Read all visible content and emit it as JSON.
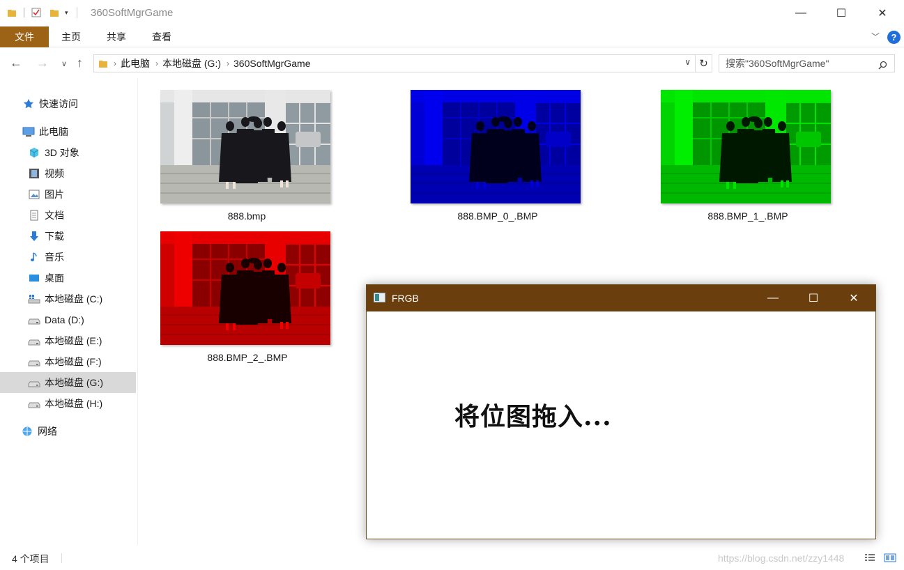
{
  "window": {
    "title": "360SoftMgrGame",
    "minimize": "—",
    "maximize": "☐",
    "close": "✕"
  },
  "ribbon": {
    "tabs": [
      {
        "label": "文件"
      },
      {
        "label": "主页"
      },
      {
        "label": "共享"
      },
      {
        "label": "查看"
      }
    ],
    "help": "?"
  },
  "address": {
    "crumbs": [
      "此电脑",
      "本地磁盘 (G:)",
      "360SoftMgrGame"
    ],
    "search_placeholder": "搜索\"360SoftMgrGame\""
  },
  "sidebar": {
    "items": [
      {
        "label": "快速访问",
        "icon": "star-icon"
      },
      {
        "label": "此电脑",
        "icon": "computer-icon"
      },
      {
        "label": "3D 对象",
        "icon": "cube-icon"
      },
      {
        "label": "视频",
        "icon": "video-icon"
      },
      {
        "label": "图片",
        "icon": "picture-icon"
      },
      {
        "label": "文档",
        "icon": "document-icon"
      },
      {
        "label": "下载",
        "icon": "download-icon"
      },
      {
        "label": "音乐",
        "icon": "music-icon"
      },
      {
        "label": "桌面",
        "icon": "desktop-icon"
      },
      {
        "label": "本地磁盘 (C:)",
        "icon": "system-drive-icon"
      },
      {
        "label": "Data (D:)",
        "icon": "drive-icon"
      },
      {
        "label": "本地磁盘 (E:)",
        "icon": "drive-icon"
      },
      {
        "label": "本地磁盘 (F:)",
        "icon": "drive-icon"
      },
      {
        "label": "本地磁盘 (G:)",
        "icon": "drive-icon",
        "selected": true
      },
      {
        "label": "本地磁盘 (H:)",
        "icon": "drive-icon"
      },
      {
        "label": "网络",
        "icon": "network-icon"
      }
    ]
  },
  "files": [
    {
      "name": "888.bmp",
      "tint": "original"
    },
    {
      "name": "888.BMP_0_.BMP",
      "tint": "#0000e0"
    },
    {
      "name": "888.BMP_1_.BMP",
      "tint": "#00d400"
    },
    {
      "name": "888.BMP_2_.BMP",
      "tint": "#e00000"
    }
  ],
  "status": {
    "count": "4 个项目",
    "watermark": "https://blog.csdn.net/zzy1448"
  },
  "frgb": {
    "title": "FRGB",
    "drop_hint": "将位图拖入...",
    "title_color": "#6b3f0d"
  }
}
